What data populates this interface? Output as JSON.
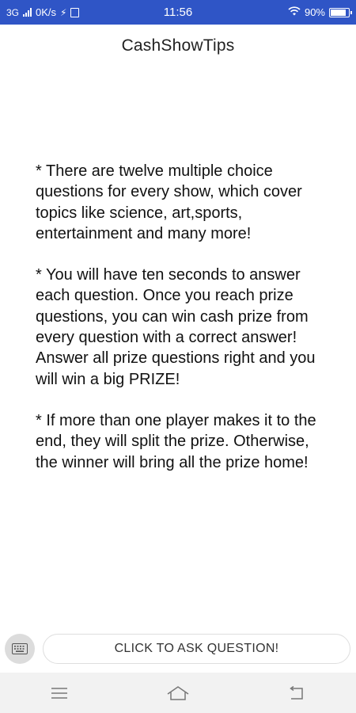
{
  "status_bar": {
    "network": "3G",
    "speed": "0K/s",
    "time": "11:56",
    "battery_percent": "90%",
    "battery_level": 0.9,
    "icons": [
      "signal-icon",
      "usb-icon",
      "sim-icon",
      "wifi-icon",
      "battery-icon"
    ]
  },
  "header": {
    "title": "CashShowTips"
  },
  "content": {
    "paragraphs": [
      "* There are twelve multiple choice questions for every show, which cover topics like science, art,sports, entertainment and many more!",
      "* You will have ten seconds to answer each question. Once you reach prize questions, you can win cash prize from every question with a correct answer! Answer all prize questions right and you will win a big PRIZE!",
      "* If more than one player makes it to the end, they will split the prize. Otherwise, the winner will bring all the prize home!"
    ]
  },
  "bottom_bar": {
    "ask_label": "CLICK TO ASK QUESTION!",
    "keyboard_icon": "keyboard-icon"
  },
  "nav_bar": {
    "icons": [
      "menu-icon",
      "home-icon",
      "back-icon"
    ]
  },
  "colors": {
    "status_bar_bg": "#2f55c6",
    "nav_bar_bg": "#f2f2f2",
    "text": "#111111"
  }
}
